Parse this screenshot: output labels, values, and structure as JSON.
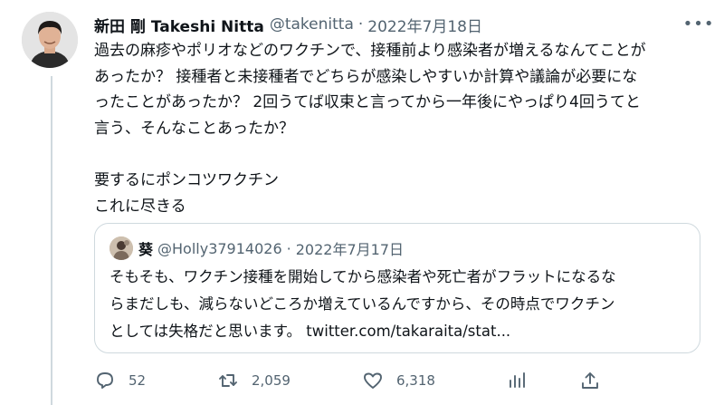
{
  "tweet": {
    "author": {
      "display_name": "新田 剛 Takeshi Nitta",
      "handle": "@takenitta",
      "avatar_icon": "person-avatar"
    },
    "separator": "·",
    "date": "2022年7月18日",
    "more_icon": "more-dots-icon",
    "body_lines": [
      "過去の麻疹やポリオなどのワクチンで、接種前より感染者が増えるなんてことが",
      "あったか？ 接種者と未接種者でどちらが感染しやすいか計算や議論が必要にな",
      "ったことがあったか？ 2回うてば収束と言ってから一年後にやっぱり4回うてと",
      "言う、そんなことあったか？",
      "",
      "要するにポンコツワクチン",
      "これに尽きる"
    ],
    "quote": {
      "display_name": "葵",
      "handle": "@Holly37914026",
      "separator": "·",
      "date": "2022年7月17日",
      "avatar_icon": "person-avatar",
      "text_lines": [
        "そもそも、ワクチン接種を開始してから感染者や死亡者がフラットになるな",
        "らまだしも、減らないどころか増えているんですから、その時点でワクチン",
        "としては失格だと思います。 twitter.com/takaraita/stat..."
      ]
    },
    "actions": {
      "reply_count": "52",
      "retweet_count": "2,059",
      "like_count": "6,318",
      "icons": [
        "reply-icon",
        "retweet-icon",
        "like-icon",
        "analytics-icon",
        "share-icon"
      ]
    },
    "colors": {
      "text": "#0f1419",
      "secondary": "#536471",
      "border": "#cfd9de"
    }
  }
}
